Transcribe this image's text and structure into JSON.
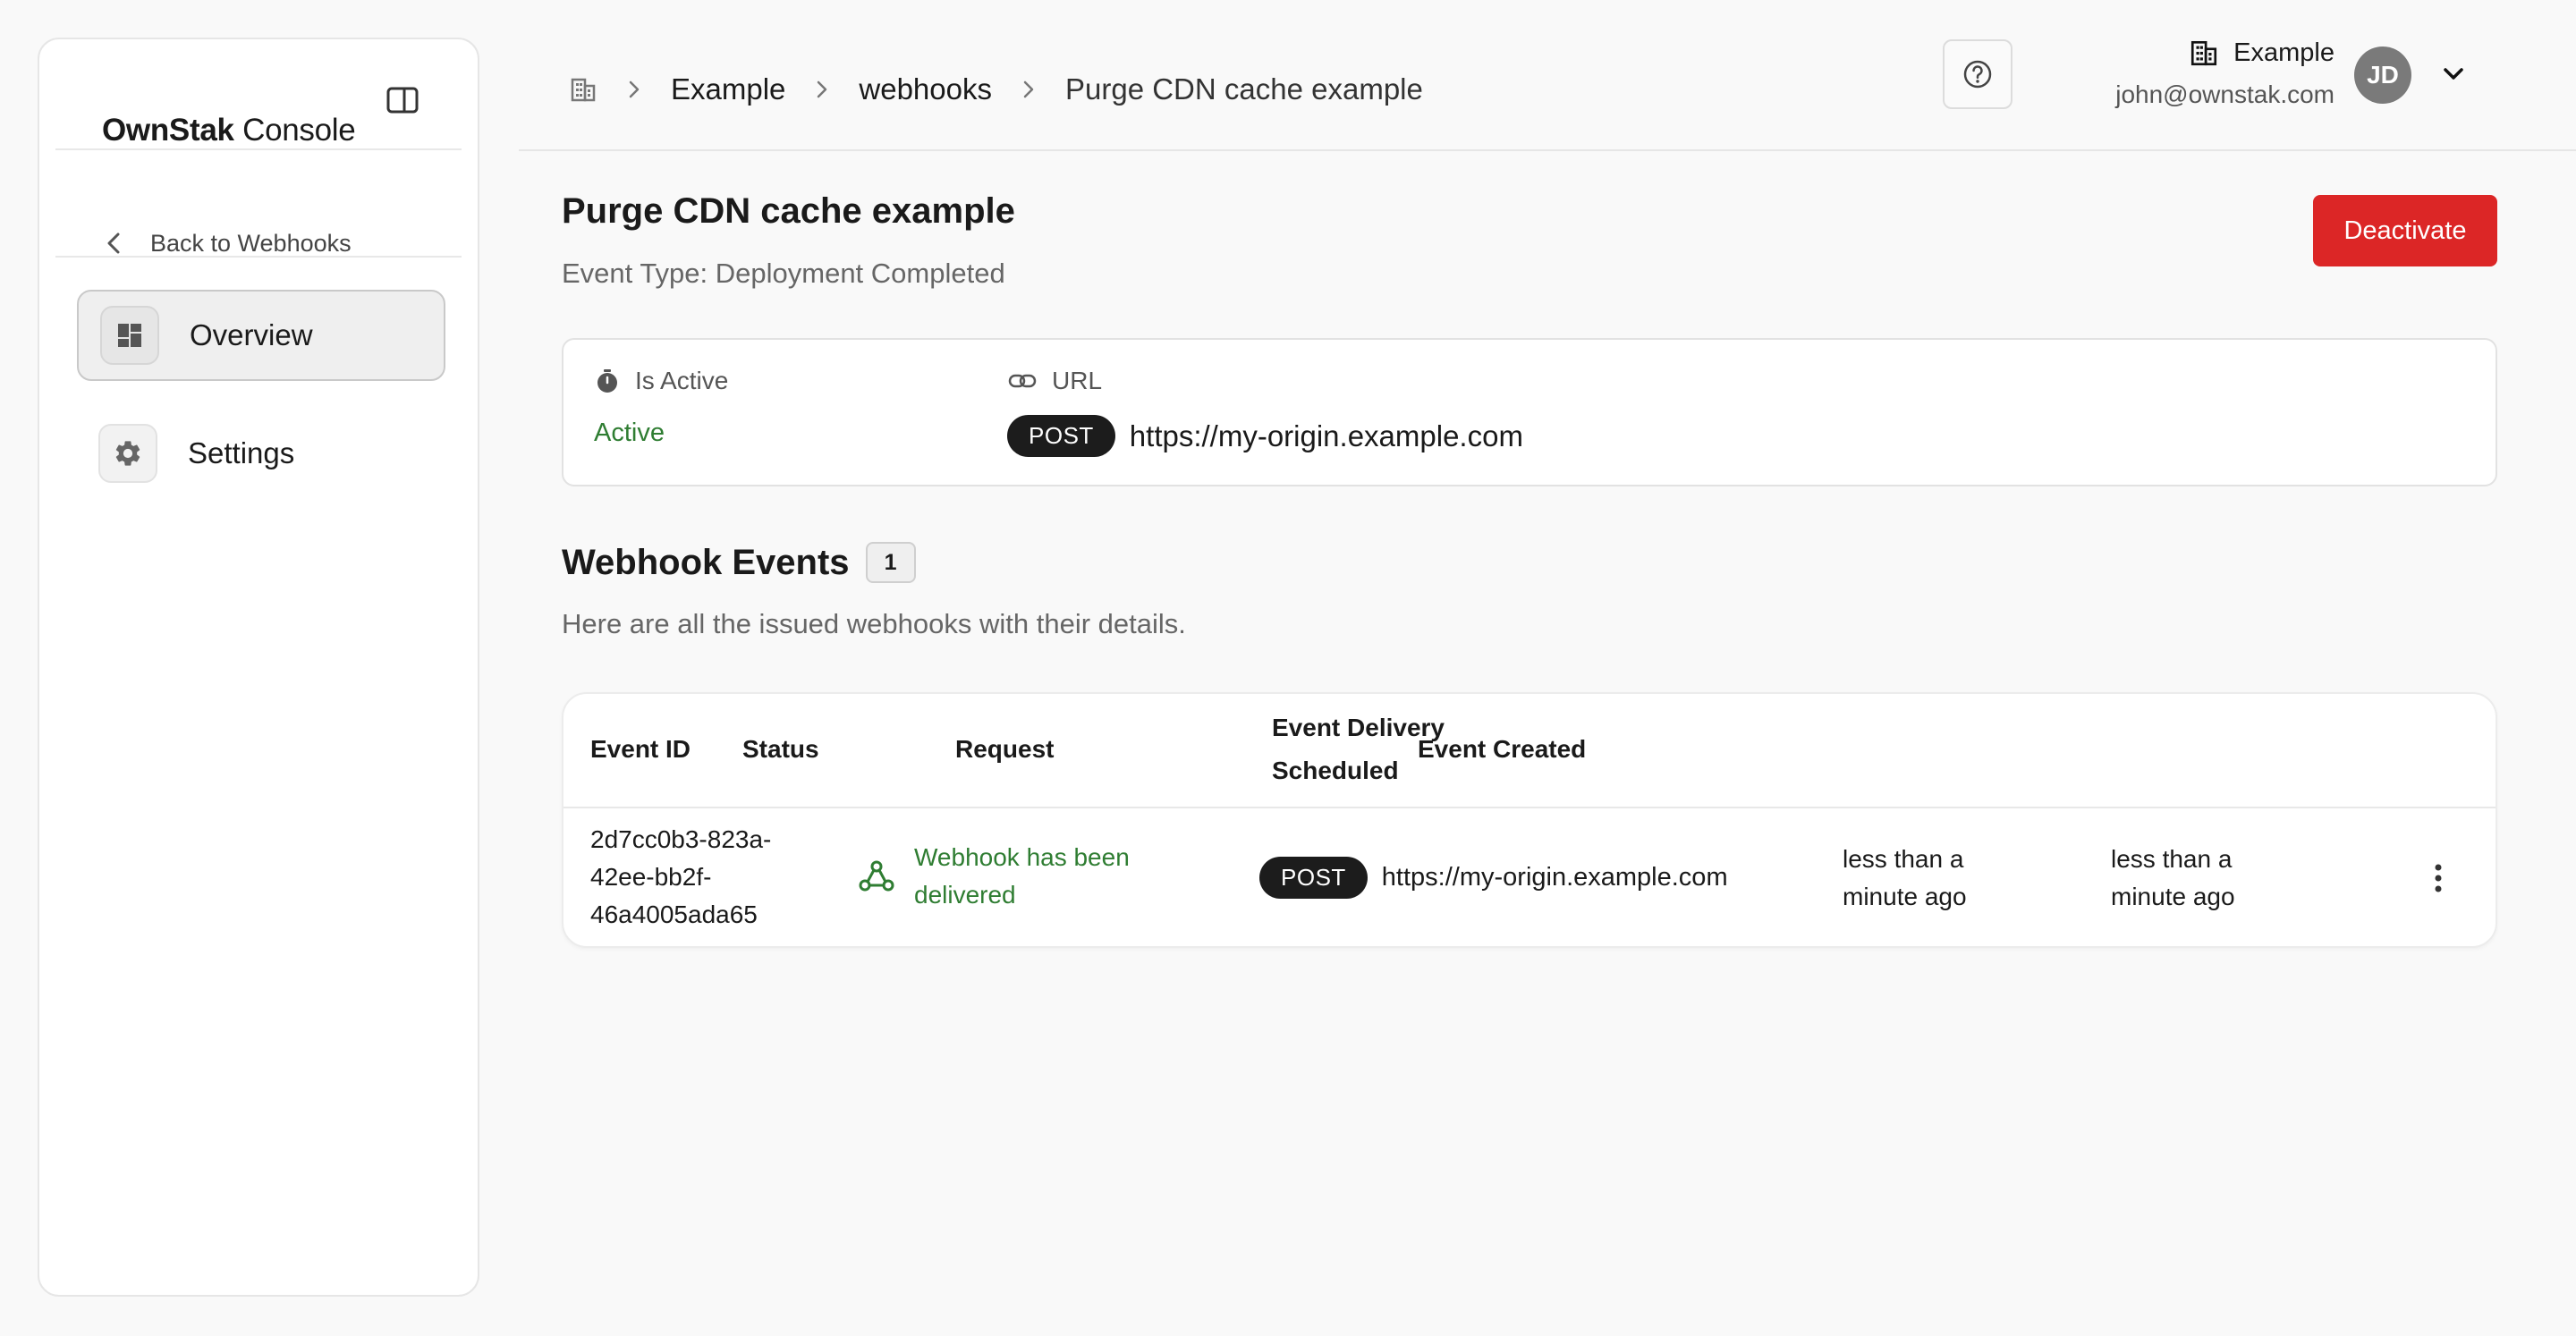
{
  "sidebar": {
    "brand_bold": "OwnStak",
    "brand_light": "Console",
    "back_label": "Back to Webhooks",
    "items": [
      {
        "label": "Overview",
        "icon": "dashboard-icon",
        "active": true
      },
      {
        "label": "Settings",
        "icon": "gear-icon",
        "active": false
      }
    ]
  },
  "header": {
    "breadcrumb": [
      "Example",
      "webhooks",
      "Purge CDN cache example"
    ],
    "org_name": "Example",
    "email": "john@ownstak.com",
    "avatar_initials": "JD"
  },
  "page": {
    "title": "Purge CDN cache example",
    "subtitle": "Event Type: Deployment Completed",
    "deactivate_label": "Deactivate"
  },
  "info": {
    "is_active_label": "Is Active",
    "is_active_value": "Active",
    "url_label": "URL",
    "method": "POST",
    "url": "https://my-origin.example.com"
  },
  "events": {
    "title": "Webhook Events",
    "count": "1",
    "subtitle": "Here are all the issued webhooks with their details.",
    "columns": {
      "event_id": "Event ID",
      "status": "Status",
      "request": "Request",
      "delivery_line1": "Event Delivery",
      "delivery_line2": "Scheduled",
      "created": "Event Created"
    },
    "rows": [
      {
        "event_id_1": "2d7cc0b3-823a-",
        "event_id_2": "42ee-bb2f-",
        "event_id_3": "46a4005ada65",
        "status_1": "Webhook has been",
        "status_2": "delivered",
        "method": "POST",
        "url": "https://my-origin.example.com",
        "delivery_1": "less than a",
        "delivery_2": "minute ago",
        "created_1": "less than a",
        "created_2": "minute ago"
      }
    ]
  },
  "colors": {
    "accent_red": "#dc2626",
    "success_green": "#2f7d32",
    "badge_dark": "#1c1c1c"
  }
}
